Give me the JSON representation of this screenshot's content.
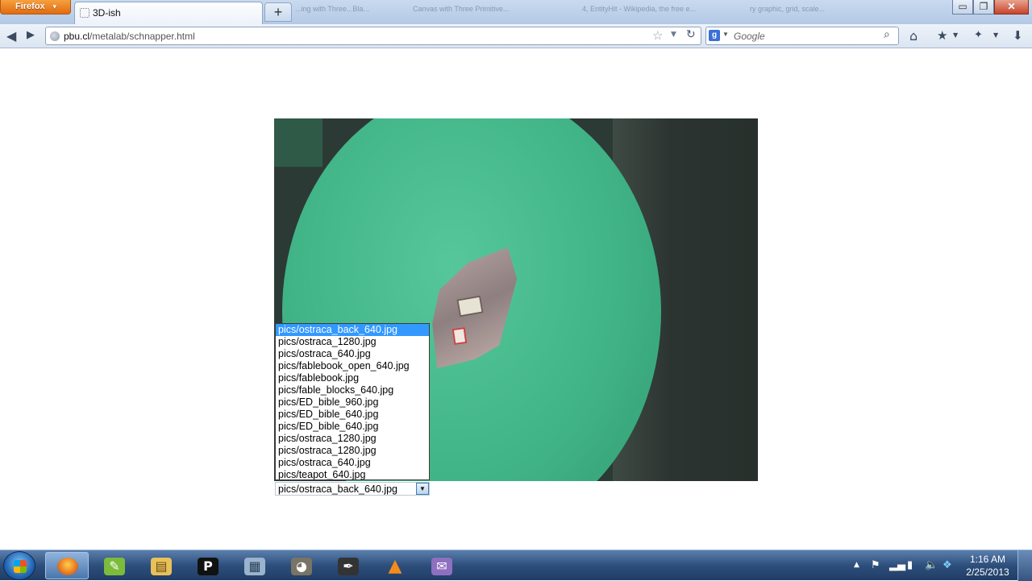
{
  "browser": {
    "app_button": "Firefox",
    "active_tab_title": "3D-ish",
    "new_tab_label": "+",
    "background_tabs": [
      "...ing with Three...Bla...",
      "Canvas with Three Primitive...",
      "4, EntityHit - Wikipedia, the free e...",
      "ry graphic, grid, scale..."
    ],
    "url_domain": "pbu.cl",
    "url_path": "/metalab/schnapper.html",
    "search_engine_letter": "g",
    "search_placeholder": "Google",
    "window_controls": {
      "minimize": "▭",
      "restore": "❐",
      "close": "✕"
    }
  },
  "page": {
    "image_select": {
      "selected": "pics/ostraca_back_640.jpg",
      "options": [
        "pics/ostraca_back_640.jpg",
        "pics/ostraca_1280.jpg",
        "pics/ostraca_640.jpg",
        "pics/fablebook_open_640.jpg",
        "pics/fablebook.jpg",
        "pics/fable_blocks_640.jpg",
        "pics/ED_bible_960.jpg",
        "pics/ED_bible_640.jpg",
        "pics/ED_bible_640.jpg",
        "pics/ostraca_1280.jpg",
        "pics/ostraca_1280.jpg",
        "pics/ostraca_640.jpg",
        "pics/teapot_640.jpg"
      ]
    }
  },
  "taskbar": {
    "apps": [
      {
        "name": "firefox",
        "icon": "firefox-icon",
        "active": true,
        "glyph": "",
        "color": "#e8741f"
      },
      {
        "name": "notepad++",
        "icon": "notepad-icon",
        "active": false,
        "glyph": "✎",
        "color": "#7dbb3b"
      },
      {
        "name": "explorer",
        "icon": "folder-icon",
        "active": false,
        "glyph": "▤",
        "color": "#e8c15a"
      },
      {
        "name": "p-app",
        "icon": "p-app-icon",
        "active": false,
        "glyph": "P",
        "color": "#111111"
      },
      {
        "name": "calculator",
        "icon": "calculator-icon",
        "active": false,
        "glyph": "▦",
        "color": "#9ab4cf"
      },
      {
        "name": "gimp",
        "icon": "gimp-icon",
        "active": false,
        "glyph": "◕",
        "color": "#7a7466"
      },
      {
        "name": "inkscape",
        "icon": "inkscape-icon",
        "active": false,
        "glyph": "✒",
        "color": "#333333"
      },
      {
        "name": "vlc",
        "icon": "vlc-icon",
        "active": false,
        "glyph": "▲",
        "color": "#f28c1c"
      },
      {
        "name": "pidgin",
        "icon": "pidgin-icon",
        "active": false,
        "glyph": "✉",
        "color": "#8e6fc0"
      }
    ],
    "clock_time": "1:16 AM",
    "clock_date": "2/25/2013"
  }
}
